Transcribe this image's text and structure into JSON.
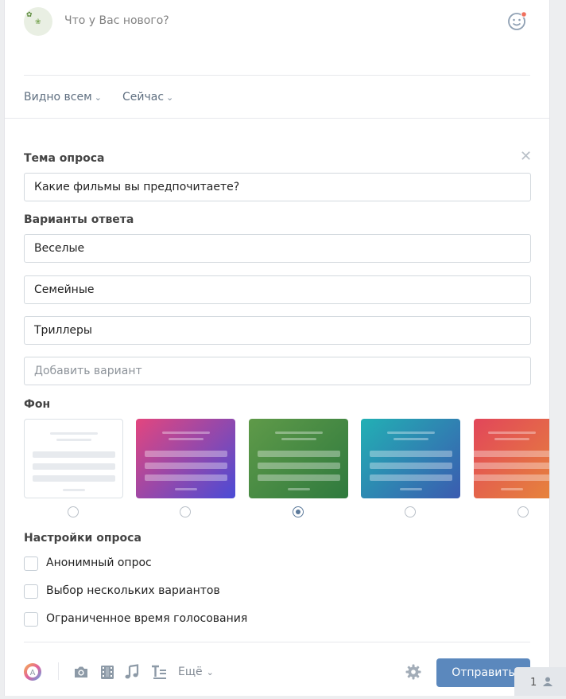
{
  "composer": {
    "placeholder": "Что у Вас нового?",
    "visibility_label": "Видно всем",
    "time_label": "Сейчас",
    "chevron": "⌄"
  },
  "poll": {
    "topic_label": "Тема опроса",
    "topic_value": "Какие фильмы вы предпочитаете?",
    "answers_label": "Варианты ответа",
    "answers": [
      "Веселые",
      "Семейные",
      "Триллеры"
    ],
    "add_placeholder": "Добавить вариант",
    "background_label": "Фон",
    "backgrounds": [
      {
        "name": "white",
        "colors": [
          "#ffffff",
          "#ffffff"
        ]
      },
      {
        "name": "pink-purple",
        "colors": [
          "#e3467e",
          "#4a4bd6"
        ]
      },
      {
        "name": "green",
        "colors": [
          "#5f9a49",
          "#2f7a3e"
        ]
      },
      {
        "name": "teal-blue",
        "colors": [
          "#22b0b4",
          "#3b5bb0"
        ]
      },
      {
        "name": "red-orange",
        "colors": [
          "#e2465a",
          "#e6833c"
        ]
      }
    ],
    "selected_background": 2,
    "settings_label": "Настройки опроса",
    "settings": [
      "Анонимный опрос",
      "Выбор нескольких вариантов",
      "Ограниченное время голосования"
    ]
  },
  "toolbar": {
    "more_label": "Ещё",
    "send_label": "Отправить",
    "icons": [
      "art-icon",
      "camera-icon",
      "video-icon",
      "music-icon",
      "text-format-icon",
      "gear-icon"
    ]
  },
  "corner": {
    "count": "1"
  },
  "colors": {
    "accent": "#5b88bd",
    "border": "#d3d9de"
  }
}
